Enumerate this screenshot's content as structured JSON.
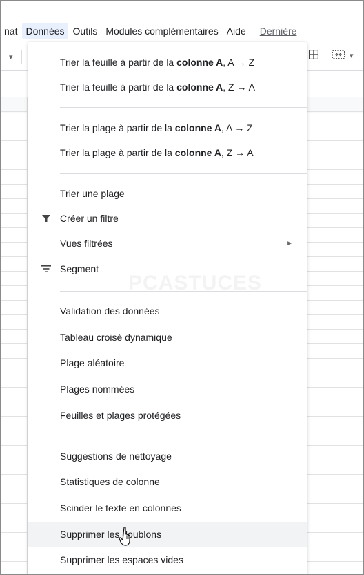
{
  "menubar": {
    "items": [
      "nat",
      "Données",
      "Outils",
      "Modules complémentaires",
      "Aide"
    ],
    "last_edit_link": "Dernière"
  },
  "menu": {
    "sort_sheet_az": {
      "pre": "Trier la feuille à partir de la ",
      "bold": "colonne A",
      "post": ", A → Z"
    },
    "sort_sheet_za": {
      "pre": "Trier la feuille à partir de la ",
      "bold": "colonne A",
      "post": ", Z → A"
    },
    "sort_range_az": {
      "pre": "Trier la plage à partir de la ",
      "bold": "colonne A",
      "post": ", A → Z"
    },
    "sort_range_za": {
      "pre": "Trier la plage à partir de la ",
      "bold": "colonne A",
      "post": ", Z → A"
    },
    "sort_range": "Trier une plage",
    "create_filter": "Créer un filtre",
    "filter_views": "Vues filtrées",
    "slicer": "Segment",
    "data_validation": "Validation des données",
    "pivot_table": "Tableau croisé dynamique",
    "randomize_range": "Plage aléatoire",
    "named_ranges": "Plages nommées",
    "protected_sheets": "Feuilles et plages protégées",
    "cleanup_suggestions": "Suggestions de nettoyage",
    "column_stats": "Statistiques de colonne",
    "split_text": "Scinder le texte en colonnes",
    "remove_duplicates": "Supprimer les doublons",
    "trim_whitespace": "Supprimer les espaces vides"
  },
  "watermark": {
    "main": "PC",
    "sub": "ASTUCES"
  },
  "colors": {
    "highlight": "#f1f3f4",
    "active_menu": "#e8f0fe",
    "separator": "#dadce0"
  }
}
